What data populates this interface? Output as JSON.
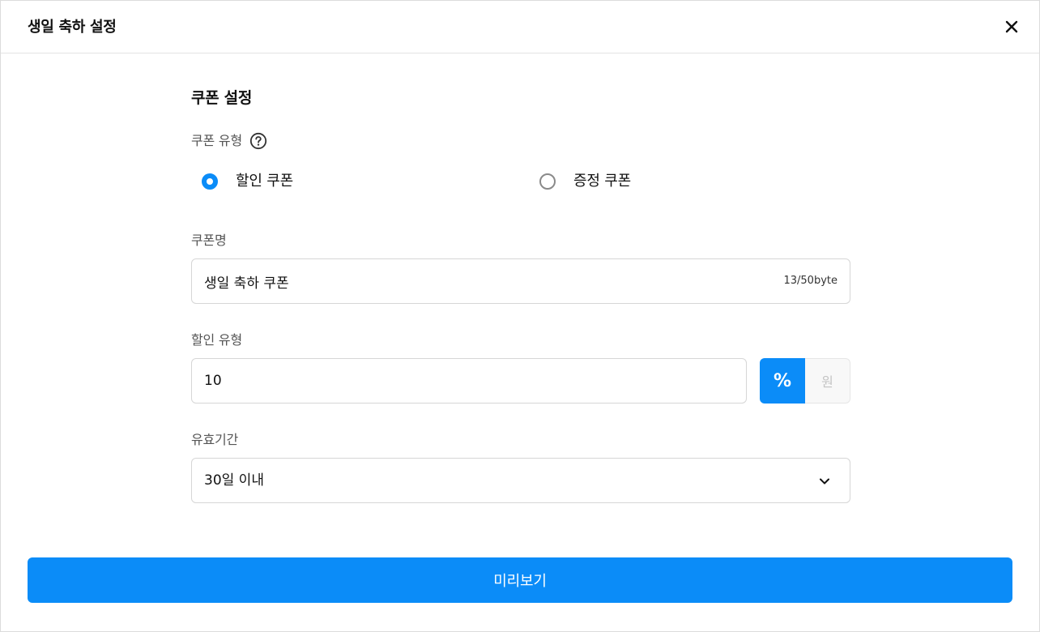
{
  "header": {
    "title": "생일 축하 설정"
  },
  "coupon_settings": {
    "section_title": "쿠폰 설정",
    "coupon_type": {
      "label": "쿠폰 유형",
      "options": [
        {
          "label": "할인 쿠폰",
          "selected": true
        },
        {
          "label": "증정 쿠폰",
          "selected": false
        }
      ]
    },
    "coupon_name": {
      "label": "쿠폰명",
      "value": "생일 축하 쿠폰",
      "byte_count": "13/50byte"
    },
    "discount_type": {
      "label": "할인 유형",
      "value": "10",
      "units": [
        {
          "label": "%",
          "selected": true
        },
        {
          "label": "원",
          "selected": false
        }
      ]
    },
    "validity": {
      "label": "유효기간",
      "selected": "30일 이내"
    }
  },
  "footer": {
    "preview_label": "미리보기"
  },
  "colors": {
    "accent": "#0b8cf8",
    "border": "#d6d6d6",
    "label": "#555555"
  }
}
